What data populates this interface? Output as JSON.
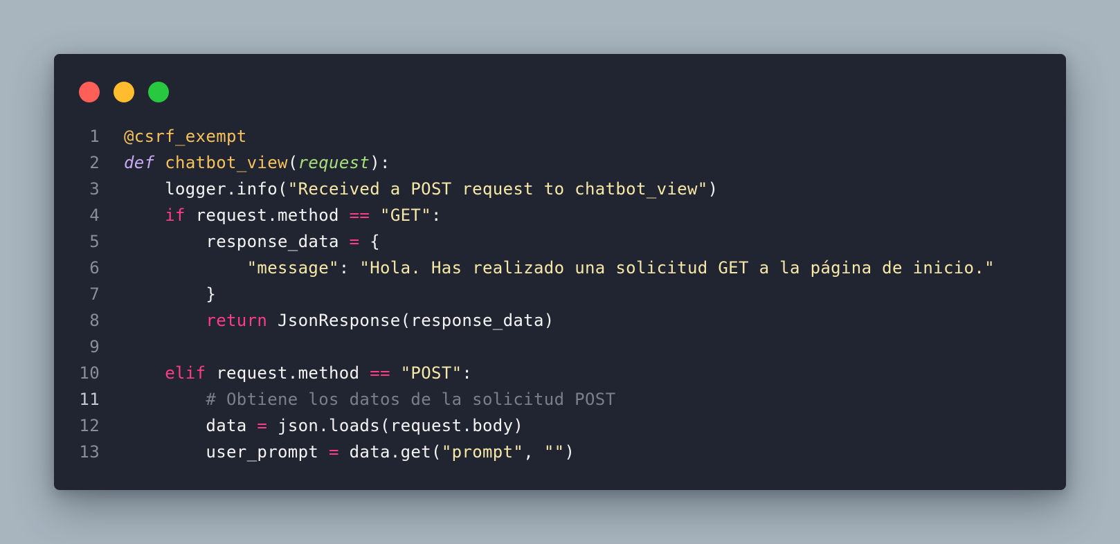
{
  "window": {
    "controls": [
      {
        "name": "close",
        "color": "#ff5f57"
      },
      {
        "name": "minimize",
        "color": "#febc2e"
      },
      {
        "name": "maximize",
        "color": "#28c840"
      }
    ]
  },
  "editor": {
    "lines": [
      {
        "number": "1",
        "indent": "",
        "tokens": [
          {
            "t": "dec",
            "v": "@csrf_exempt"
          }
        ]
      },
      {
        "number": "2",
        "indent": "",
        "tokens": [
          {
            "t": "kw-italic",
            "v": "def"
          },
          {
            "t": "plain",
            "v": " "
          },
          {
            "t": "fn",
            "v": "chatbot_view"
          },
          {
            "t": "plain",
            "v": "("
          },
          {
            "t": "param",
            "v": "request"
          },
          {
            "t": "plain",
            "v": "):"
          }
        ]
      },
      {
        "number": "3",
        "indent": "    ",
        "tokens": [
          {
            "t": "plain",
            "v": "logger.info("
          },
          {
            "t": "str",
            "v": "\"Received a POST request to chatbot_view\""
          },
          {
            "t": "plain",
            "v": ")"
          }
        ]
      },
      {
        "number": "4",
        "indent": "    ",
        "tokens": [
          {
            "t": "kw",
            "v": "if"
          },
          {
            "t": "plain",
            "v": " request.method "
          },
          {
            "t": "op",
            "v": "=="
          },
          {
            "t": "plain",
            "v": " "
          },
          {
            "t": "str",
            "v": "\"GET\""
          },
          {
            "t": "plain",
            "v": ":"
          }
        ]
      },
      {
        "number": "5",
        "indent": "        ",
        "tokens": [
          {
            "t": "plain",
            "v": "response_data "
          },
          {
            "t": "op",
            "v": "="
          },
          {
            "t": "plain",
            "v": " {"
          }
        ]
      },
      {
        "number": "6",
        "indent": "            ",
        "tokens": [
          {
            "t": "str",
            "v": "\"message\""
          },
          {
            "t": "plain",
            "v": ": "
          },
          {
            "t": "str",
            "v": "\"Hola. Has realizado una solicitud GET a la página de inicio.\""
          }
        ]
      },
      {
        "number": "7",
        "indent": "        ",
        "tokens": [
          {
            "t": "plain",
            "v": "}"
          }
        ]
      },
      {
        "number": "8",
        "indent": "        ",
        "tokens": [
          {
            "t": "kw",
            "v": "return"
          },
          {
            "t": "plain",
            "v": " JsonResponse(response_data)"
          }
        ]
      },
      {
        "number": "9",
        "indent": "",
        "tokens": []
      },
      {
        "number": "10",
        "indent": "    ",
        "tokens": [
          {
            "t": "kw",
            "v": "elif"
          },
          {
            "t": "plain",
            "v": " request.method "
          },
          {
            "t": "op",
            "v": "=="
          },
          {
            "t": "plain",
            "v": " "
          },
          {
            "t": "str",
            "v": "\"POST\""
          },
          {
            "t": "plain",
            "v": ":"
          }
        ]
      },
      {
        "number": "11",
        "indent": "        ",
        "current": true,
        "tokens": [
          {
            "t": "comment",
            "v": "# Obtiene los datos de la solicitud POST"
          }
        ]
      },
      {
        "number": "12",
        "indent": "        ",
        "tokens": [
          {
            "t": "plain",
            "v": "data "
          },
          {
            "t": "op",
            "v": "="
          },
          {
            "t": "plain",
            "v": " json.loads(request.body)"
          }
        ]
      },
      {
        "number": "13",
        "indent": "        ",
        "tokens": [
          {
            "t": "plain",
            "v": "user_prompt "
          },
          {
            "t": "op",
            "v": "="
          },
          {
            "t": "plain",
            "v": " data.get("
          },
          {
            "t": "str",
            "v": "\"prompt\""
          },
          {
            "t": "plain",
            "v": ", "
          },
          {
            "t": "str",
            "v": "\"\""
          },
          {
            "t": "plain",
            "v": ")"
          }
        ]
      }
    ]
  }
}
